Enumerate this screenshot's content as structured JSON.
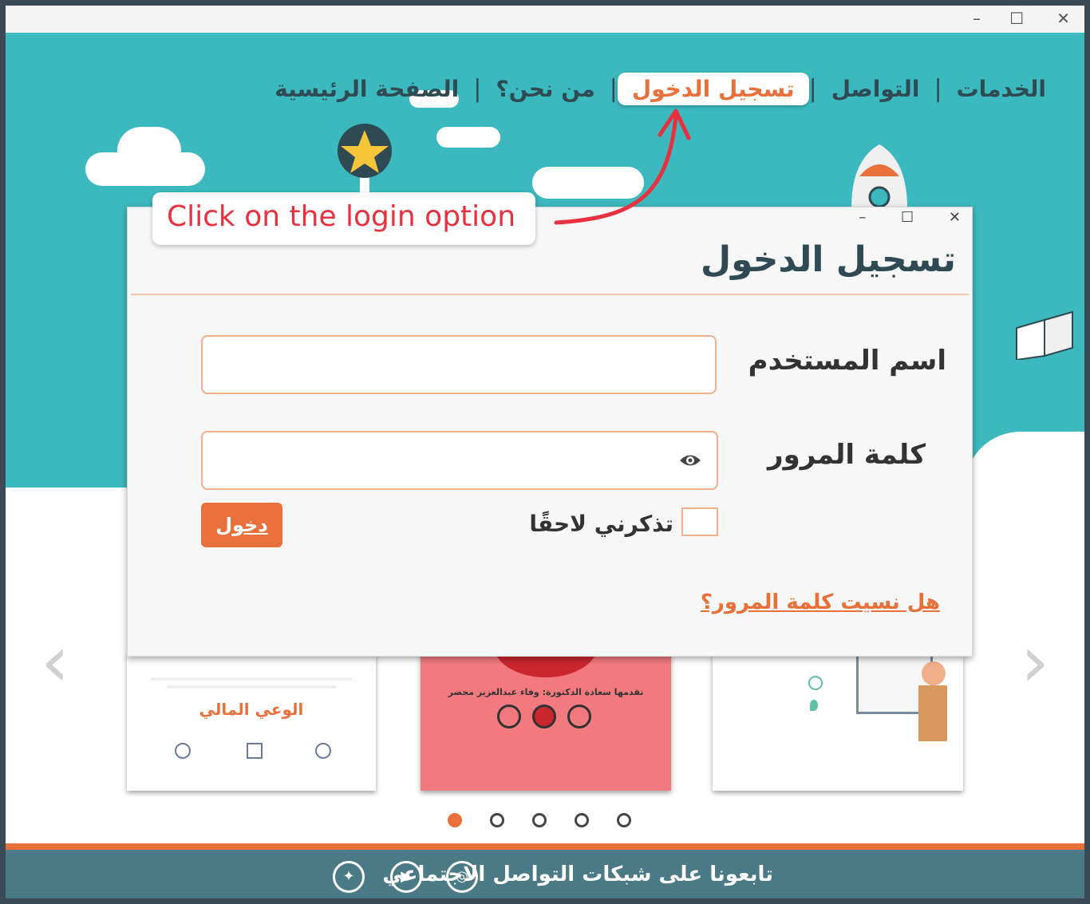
{
  "window": {
    "minimize": "–",
    "maximize": "☐",
    "close": "✕"
  },
  "nav": {
    "home": "الصفحة الرئيسية",
    "about": "من نحن؟",
    "login": "تسجيل الدخول",
    "contact": "التواصل",
    "services": "الخدمات",
    "separator": "|"
  },
  "annotation": {
    "text": "Click on the login option"
  },
  "dialog": {
    "title": "تسجيل الدخول",
    "minimize": "–",
    "maximize": "☐",
    "close": "✕",
    "username_label": "اسم المستخدم",
    "username_value": "",
    "password_label": "كلمة المرور",
    "password_value": "",
    "remember_label": "تذكرني لاحقًا",
    "login_button": "دخول",
    "forgot_link": "هل نسيت كلمة المرور؟"
  },
  "carousel": {
    "cards": [
      {
        "title": "الوعي المالي"
      },
      {
        "title": "تقدمها سعادة الدكتورة: وفاء عبدالعزيز محضر"
      },
      {
        "title": ""
      }
    ],
    "active_index": 0,
    "total": 5
  },
  "footer": {
    "text": "تابعونا على شبكات التواصل الاجتماعي"
  },
  "colors": {
    "teal": "#3cb9bf",
    "accent": "#e8703a",
    "dark": "#2f4a52"
  }
}
